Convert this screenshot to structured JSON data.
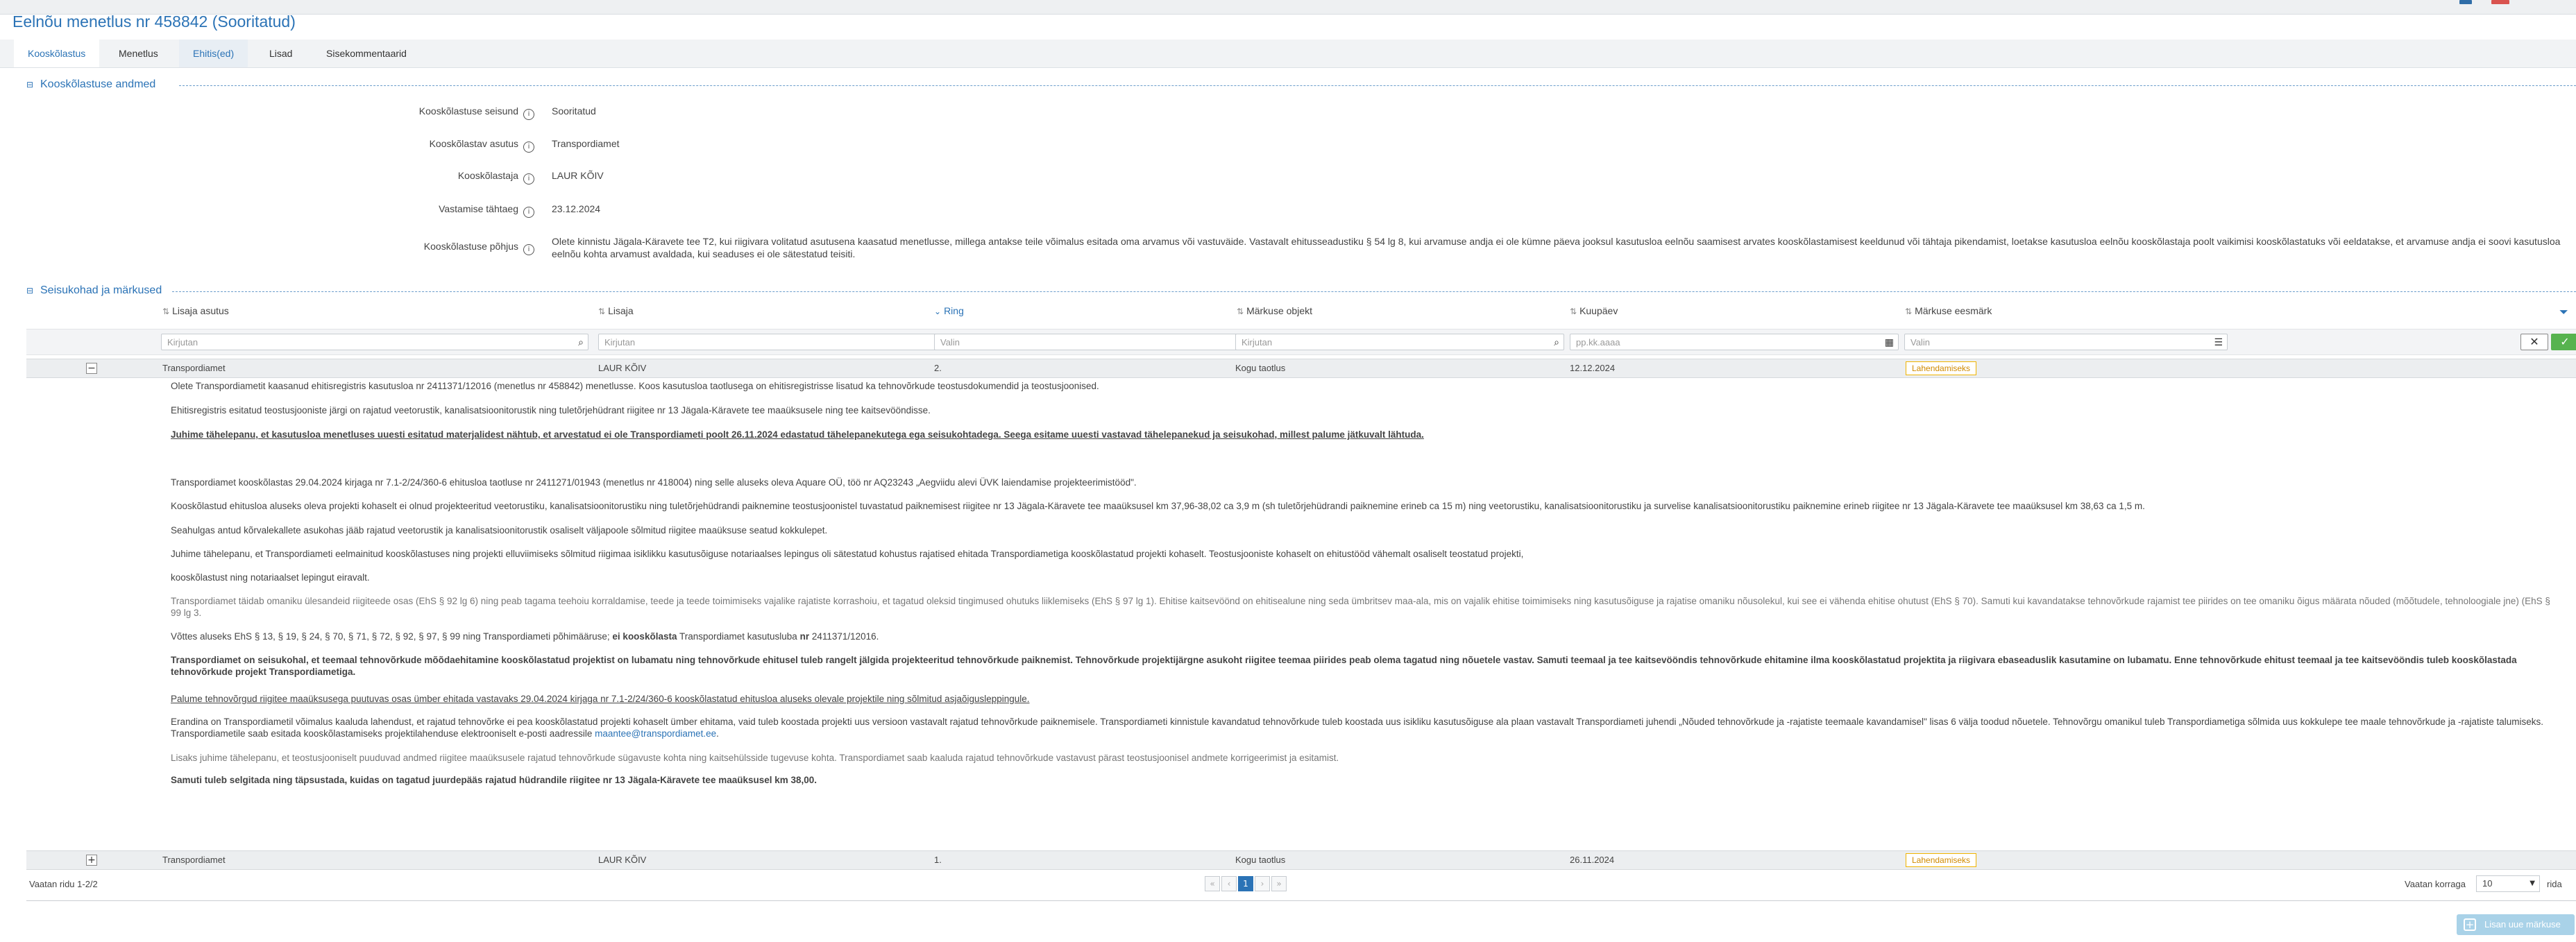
{
  "page_title": "Eelnõu menetlus nr 458842 (Sooritatud)",
  "tabs": [
    {
      "label": "Kooskõlastus"
    },
    {
      "label": "Menetlus"
    },
    {
      "label": "Ehitis(ed)"
    },
    {
      "label": "Lisad"
    },
    {
      "label": "Sisekommentaarid"
    }
  ],
  "active_tab": "Kooskõlastus",
  "section1": {
    "title": "Kooskõlastuse andmed",
    "fields": [
      {
        "label": "Kooskõlastuse seisund",
        "value": "Sooritatud"
      },
      {
        "label": "Kooskõlastav asutus",
        "value": "Transpordiamet"
      },
      {
        "label": "Kooskõlastaja",
        "value": "LAUR KÕIV"
      },
      {
        "label": "Vastamise tähtaeg",
        "value": "23.12.2024"
      },
      {
        "label": "Kooskõlastuse põhjus",
        "value": "Olete kinnistu Jägala-Käravete tee T2, kui riigivara volitatud asutusena kaasatud menetlusse, millega antakse teile võimalus esitada oma arvamus või vastuväide. Vastavalt ehitusseadustiku § 54 lg 8, kui arvamuse andja ei ole kümne päeva jooksul kasutusloa eelnõu saamisest arvates kooskõlastamisest keeldunud või tähtaja pikendamist, loetakse kasutusloa eelnõu kooskõlastaja poolt vaikimisi kooskõlastatuks või eeldatakse, et arvamuse andja ei soovi kasutusloa eelnõu kohta arvamust avaldada, kui seaduses ei ole sätestatud teisiti."
      }
    ]
  },
  "section2": {
    "title": "Seisukohad ja märkused",
    "columns": [
      "Lisaja asutus",
      "Lisaja",
      "Ring",
      "Märkuse objekt",
      "Kuupäev",
      "Märkuse eesmärk"
    ],
    "filters": [
      "Kirjutan",
      "Kirjutan",
      "Valin",
      "Kirjutan",
      "pp.kk.aaaa",
      "Valin"
    ],
    "rows": [
      {
        "expander": "−",
        "asutus": "Transpordiamet",
        "lisaja": "LAUR KÕIV",
        "ring": "2.",
        "objekt": "Kogu taotlus",
        "kuupaev": "12.12.2024",
        "eesmark": "Lahendamiseks"
      },
      {
        "expander": "+",
        "asutus": "Transpordiamet",
        "lisaja": "LAUR KÕIV",
        "ring": "1.",
        "objekt": "Kogu taotlus",
        "kuupaev": "26.11.2024",
        "eesmark": "Lahendamiseks"
      }
    ],
    "detail": {
      "p1": "Olete Transpordiametit kaasanud ehitisregistris kasutusloa nr 2411371/12016 (menetlus nr 458842) menetlusse. Koos kasutusloa taotlusega on ehitisregistrisse lisatud ka tehnovõrkude teostusdokumendid ja teostusjoonised.",
      "p2": "Ehitisregistris esitatud teostusjooniste järgi on rajatud veetorustik, kanalisatsioonitorustik ning tuletõrjehüdrant riigitee nr 13 Jägala-Käravete tee maaüksusele ning tee kaitsevööndisse.",
      "p3": "Juhime tähelepanu, et kasutusloa menetluses uuesti esitatud materjalidest nähtub, et arvestatud ei ole Transpordiameti poolt 26.11.2024 edastatud tähelepanekutega ega seisukohtadega. Seega esitame uuesti vastavad tähelepanekud ja seisukohad, millest palume jätkuvalt lähtuda.",
      "p4": "Transpordiamet kooskõlastas 29.04.2024 kirjaga nr 7.1-2/24/360-6 ehitusloa taotluse nr 2411271/01943 (menetlus nr 418004) ning selle aluseks oleva Aquare OÜ, töö nr AQ23243 „Aegviidu alevi ÜVK laiendamise projekteerimistööd\".",
      "p5": "Kooskõlastud ehitusloa aluseks oleva projekti kohaselt ei olnud projekteeritud veetorustiku, kanalisatsioonitorustiku ning tuletõrjehüdrandi paiknemine teostusjoonistel tuvastatud paiknemisest riigitee nr 13 Jägala-Käravete tee maaüksusel km 37,96-38,02 ca 3,9 m (sh tuletõrjehüdrandi paiknemine erineb ca 15 m) ning veetorustiku, kanalisatsioonitorustiku ja survelise kanalisatsioonitorustiku paiknemine erineb riigitee nr 13 Jägala-Käravete tee maaüksusel km 38,63 ca 1,5 m.",
      "p6": "Seahulgas antud kõrvalekallete asukohas jääb rajatud veetorustik ja kanalisatsioonitorustik osaliselt väljapoole sõlmitud riigitee maaüksuse seatud kokkulepet.",
      "p7": "Juhime tähelepanu, et Transpordiameti eelmainitud kooskõlastuses ning projekti elluviimiseks sõlmitud riigimaa isiklikku kasutusõiguse notariaalses lepingus oli sätestatud kohustus rajatised ehitada Transpordiametiga kooskõlastatud projekti kohaselt. Teostusjooniste kohaselt on ehitustööd vähemalt osaliselt teostatud projekti,",
      "p8": "kooskõlastust ning notariaalset lepingut eiravalt.",
      "p9": "Transpordiamet täidab omaniku ülesandeid riigiteede osas (EhS § 92 lg 6) ning peab tagama teehoiu korraldamise, teede ja teede toimimiseks vajalike rajatiste korrashoiu, et tagatud oleksid tingimused ohutuks liiklemiseks (EhS § 97 lg 1). Ehitise kaitsevöönd on ehitisealune ning seda ümbritsev maa-ala, mis on vajalik ehitise toimimiseks ning kasutusõiguse ja rajatise omaniku nõusolekul, kui see ei vähenda ehitise ohutust (EhS § 70). Samuti kui kavandatakse tehnovõrkude rajamist tee piirides on tee omaniku õigus määrata nõuded (mõõtudele, tehnoloogiale jne) (EhS § 99 lg 3.",
      "p10a": "Võttes aluseks EhS § 13, § 19, § 24, § 70, § 71, § 72, § 92, § 97, § 99 ning Transpordiameti põhimääruse; ",
      "p10b": "ei kooskõlasta",
      "p10c": " Transpordiamet kasutusluba ",
      "p10d": "nr",
      "p10e": " 2411371/12016.",
      "p11": "Transpordiamet on seisukohal, et teemaal tehnovõrkude mõõdaehitamine kooskõlastatud projektist on lubamatu ning tehnovõrkude ehitusel tuleb rangelt jälgida projekteeritud tehnovõrkude paiknemist. Tehnovõrkude projektijärgne asukoht riigitee teemaa piirides peab olema tagatud ning nõuetele vastav. Samuti teemaal ja tee kaitsevööndis tehnovõrkude ehitamine ilma kooskõlastatud projektita ja riigivara ebaseaduslik kasutamine on lubamatu. Enne tehnovõrkude ehitust teemaal ja tee kaitsevööndis tuleb kooskõlastada tehnovõrkude projekt Transpordiametiga.",
      "p12": "Palume tehnovõrgud riigitee maaüksusega puutuvas osas ümber ehitada vastavaks 29.04.2024 kirjaga nr 7.1-2/24/360-6 kooskõlastatud ehitusloa aluseks olevale projektile ning sõlmitud asjaõigusleppingule.",
      "p13": "Erandina on Transpordiametil võimalus kaaluda lahendust, et rajatud tehnovõrke ei pea kooskõlastatud projekti kohaselt ümber ehitama, vaid tuleb koostada projekti uus versioon vastavalt rajatud tehnovõrkude paiknemisele. Transpordiameti kinnistule kavandatud tehnovõrkude tuleb koostada uus isikliku kasutusõiguse ala plaan vastavalt Transpordiameti juhendi „Nõuded tehnovõrkude ja -rajatiste teemaale kavandamisel\" lisas 6 välja toodud nõuetele. Tehnovõrgu omanikul tuleb Transpordiametiga sõlmida uus kokkulepe tee maale tehnovõrkude ja -rajatiste talumiseks. Transpordiametile saab esitada kooskõlastamiseks projektilahenduse elektrooniselt e-posti aadressile ",
      "p13_link": "maantee@transpordiamet.ee",
      "p13_end": ".",
      "p14": "Lisaks juhime tähelepanu, et teostusjooniselt puuduvad andmed riigitee maaüksusele rajatud tehnovõrkude sügavuste kohta ning kaitsehülsside tugevuse kohta. Transpordiamet saab kaaluda rajatud tehnovõrkude vastavust pärast teostusjoonisel andmete korrigeerimist ja esitamist.",
      "p15": "Samuti tuleb selgitada ning täpsustada, kuidas on tagatud juurdepääs rajatud hüdrandile riigitee nr 13 Jägala-Käravete tee maaüksusel km 38,00."
    }
  },
  "footer": {
    "count": "Vaatan ridu 1-2/2",
    "current_page": "1",
    "per_page_label": "Vaatan korraga",
    "per_page": "10",
    "per_page_suffix": "rida"
  },
  "add_button": "Lisan uue märkuse",
  "colors": {
    "accent": "#2b73b6",
    "badge": "#f0b400",
    "ok": "#57b34f"
  },
  "icons": [
    "info-icon",
    "sort-icon",
    "search-icon",
    "list-icon",
    "calendar-icon",
    "filter-icon",
    "close-icon",
    "check-icon",
    "plus-icon"
  ]
}
